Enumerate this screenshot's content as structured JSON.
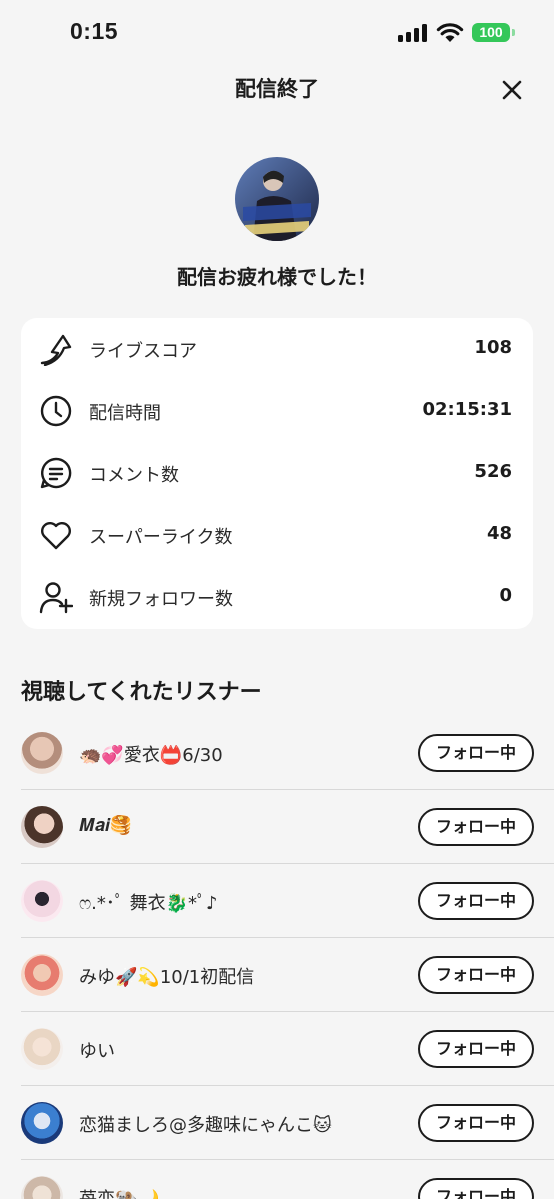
{
  "status_bar": {
    "time": "0:15",
    "battery": "100"
  },
  "header": {
    "title": "配信終了"
  },
  "summary": {
    "message": "配信お疲れ様でした！"
  },
  "stats": [
    {
      "icon": "score-arrow-icon",
      "label": "ライブスコア",
      "value": "108"
    },
    {
      "icon": "clock-icon",
      "label": "配信時間",
      "value": "02:15:31"
    },
    {
      "icon": "comment-icon",
      "label": "コメント数",
      "value": "526"
    },
    {
      "icon": "heart-icon",
      "label": "スーパーライク数",
      "value": "48"
    },
    {
      "icon": "add-user-icon",
      "label": "新規フォロワー数",
      "value": "0"
    }
  ],
  "listeners_section": {
    "title": "視聴してくれたリスナー"
  },
  "listeners": [
    {
      "name": "🦔💞愛衣📛6/30",
      "button": "フォロー中"
    },
    {
      "name": "𝑴𝒂𝒊🥞",
      "button": "フォロー中"
    },
    {
      "name": "ෆ.*･ﾟ 舞衣🐉*ﾟ♪",
      "button": "フォロー中"
    },
    {
      "name": "みゆ🚀💫10/1初配信",
      "button": "フォロー中"
    },
    {
      "name": "ゆい",
      "button": "フォロー中"
    },
    {
      "name": "恋猫ましろ@多趣味にゃんこ🐱",
      "button": "フォロー中"
    },
    {
      "name": "苺恋🐏🌙",
      "button": "フォロー中"
    }
  ],
  "colors": {
    "background": "#f5f5f5",
    "card": "#ffffff",
    "battery": "#34c759",
    "text": "#1c1c1c"
  }
}
